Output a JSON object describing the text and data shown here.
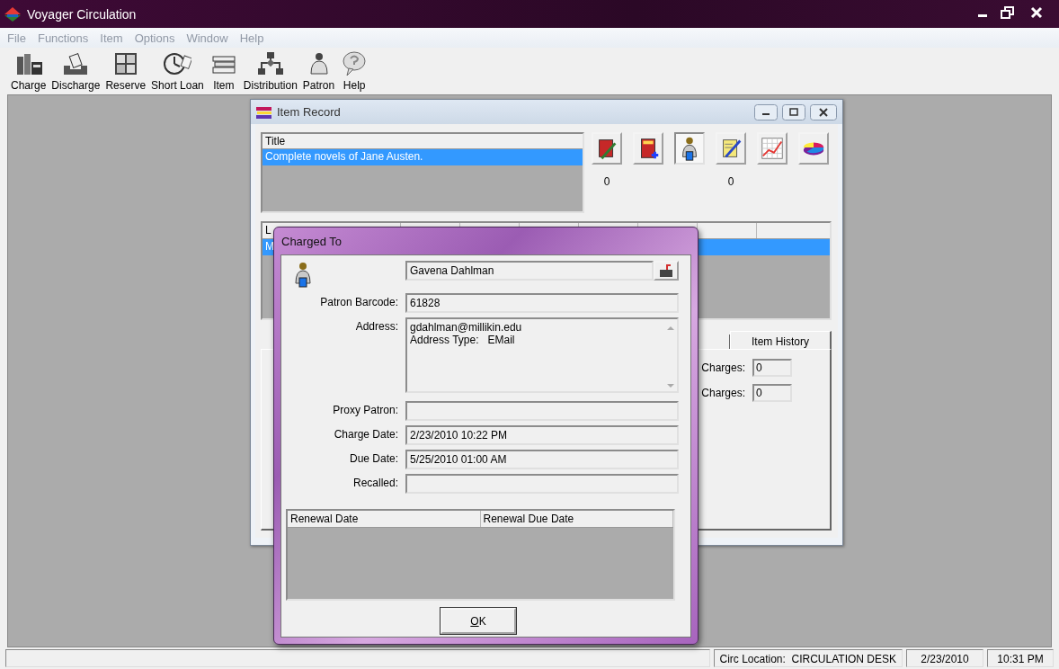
{
  "window": {
    "title": "Voyager Circulation"
  },
  "menu": [
    {
      "label": "File",
      "disabled": true
    },
    {
      "label": "Functions",
      "disabled": true
    },
    {
      "label": "Item",
      "disabled": true
    },
    {
      "label": "Options",
      "disabled": true
    },
    {
      "label": "Window",
      "disabled": true
    },
    {
      "label": "Help",
      "disabled": true
    }
  ],
  "toolbar": [
    {
      "label": "Charge",
      "kind": "charge"
    },
    {
      "label": "Discharge",
      "kind": "discharge"
    },
    {
      "label": "Reserve",
      "kind": "reserve"
    },
    {
      "label": "Short Loan",
      "kind": "shortloan"
    },
    {
      "label": "Item",
      "kind": "item"
    },
    {
      "label": "Distribution",
      "kind": "distribution"
    },
    {
      "label": "Patron",
      "kind": "patron"
    },
    {
      "label": "Help",
      "kind": "help"
    }
  ],
  "item_record": {
    "title": "Item Record",
    "title_list": {
      "column": "Title",
      "rows": [
        {
          "text": "Complete novels of Jane Austen.",
          "selected": true
        }
      ]
    },
    "action_buttons": [
      {
        "kind": "edit",
        "pressed": false,
        "count": "0"
      },
      {
        "kind": "add",
        "pressed": false
      },
      {
        "kind": "patron",
        "pressed": true
      },
      {
        "kind": "notes",
        "pressed": false,
        "count": "0"
      },
      {
        "kind": "chart",
        "pressed": false
      },
      {
        "kind": "pie",
        "pressed": false
      }
    ],
    "location_table": {
      "column_1": "L",
      "rows": [
        {
          "column_1": "M",
          "selected": true
        }
      ]
    },
    "tabs": [
      {
        "label": "Item History",
        "selected": false
      }
    ],
    "charge_fields": [
      {
        "label": "Charges:",
        "value": "0"
      },
      {
        "label": "Charges:",
        "value": "0"
      }
    ]
  },
  "dialog": {
    "title": "Charged To",
    "patron_name": "Gavena Dahlman",
    "fields": [
      {
        "kind": "line",
        "label": "Patron Barcode:",
        "value": "61828"
      },
      {
        "kind": "multiline",
        "label": "Address:",
        "lines": [
          "gdahlman@millikin.edu",
          "Address Type:   EMail"
        ]
      },
      {
        "kind": "line",
        "label": "Proxy Patron:"
      },
      {
        "kind": "line",
        "label": "Charge Date:",
        "value": "2/23/2010  10:22 PM"
      },
      {
        "kind": "line",
        "label": "Due Date:",
        "value": "5/25/2010  01:00 AM"
      },
      {
        "kind": "line",
        "label": "Recalled:"
      }
    ],
    "renewal_table": {
      "columns": [
        "Renewal Date",
        "Renewal Due Date"
      ]
    },
    "ok_button": "OK"
  },
  "status_bar": [
    "Circ Location:  CIRCULATION DESK",
    "2/23/2010",
    "10:31 PM"
  ]
}
